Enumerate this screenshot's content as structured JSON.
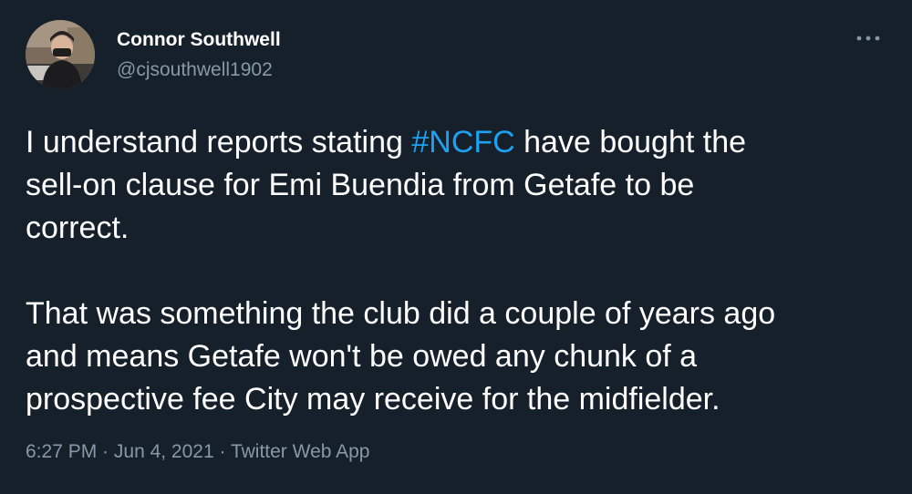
{
  "author": {
    "display_name": "Connor Southwell",
    "handle": "@cjsouthwell1902",
    "avatar_icon": "profile-photo"
  },
  "menu": {
    "more_icon": "more-horizontal-icon"
  },
  "tweet": {
    "line1_pre": "I understand reports stating ",
    "hashtag": "#NCFC",
    "line1_post": " have bought the",
    "line2": "sell-on clause for Emi Buendia from Getafe to be",
    "line3": "correct.",
    "line4": "That was something the club did a couple of years ago",
    "line5": "and means Getafe won't be owed any chunk of a",
    "line6": "prospective fee City may receive for the midfielder."
  },
  "meta": {
    "time": "6:27 PM",
    "separator": " · ",
    "date": "Jun 4, 2021",
    "source": "Twitter Web App"
  },
  "colors": {
    "background": "#15202b",
    "text": "#ffffff",
    "secondary_text": "#8899a6",
    "hashtag": "#1da1f2"
  }
}
